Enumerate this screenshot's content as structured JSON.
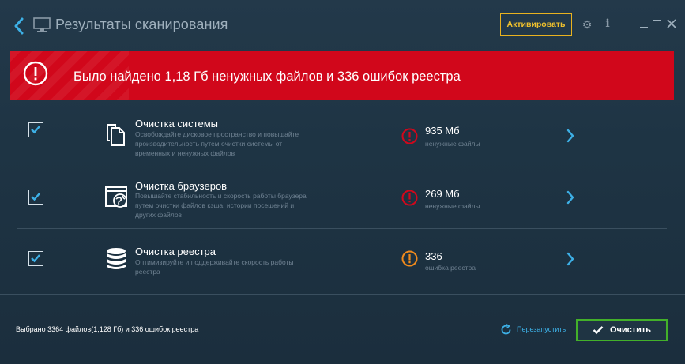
{
  "titlebar": {
    "title": "Результаты сканирования",
    "activate_label": "Активировать",
    "gear_glyph": "⚙",
    "info_glyph": "i"
  },
  "banner": {
    "message": "Было найдено 1,18 Гб ненужных файлов и 336 ошибок реестра",
    "color": "#d1071b"
  },
  "rows": [
    {
      "title": "Очистка системы",
      "desc": "Освобождайте дисковое пространство и повышайте производительность путем очистки системы от временных и ненужных файлов",
      "value": "935 Мб",
      "unit": "ненужные файлы",
      "icon": "files-icon",
      "status": "error",
      "checked": true
    },
    {
      "title": "Очистка браузеров",
      "desc": "Повышайте стабильность и скорость работы браузера путем очистки файлов кэша, истории посещений и других файлов",
      "value": "269 Мб",
      "unit": "ненужные файлы",
      "icon": "browser-icon",
      "status": "error",
      "checked": true
    },
    {
      "title": "Очистка реестра",
      "desc": "Оптимизируйте и поддерживайте скорость работы реестра",
      "value": "336",
      "unit": "ошибка реестра",
      "icon": "registry-icon",
      "status": "warning",
      "checked": true
    }
  ],
  "footer": {
    "status": "Выбрано 3364 файлов(1,128 Гб) и 336 ошибок реестра",
    "restart_label": "Перезапустить",
    "clean_label": "Очистить"
  },
  "colors": {
    "accent_blue": "#3db0e6",
    "error_red": "#d1071b",
    "warning_orange": "#f08a1c",
    "activate_yellow": "#e9b21f",
    "clean_green": "#43b02a"
  }
}
